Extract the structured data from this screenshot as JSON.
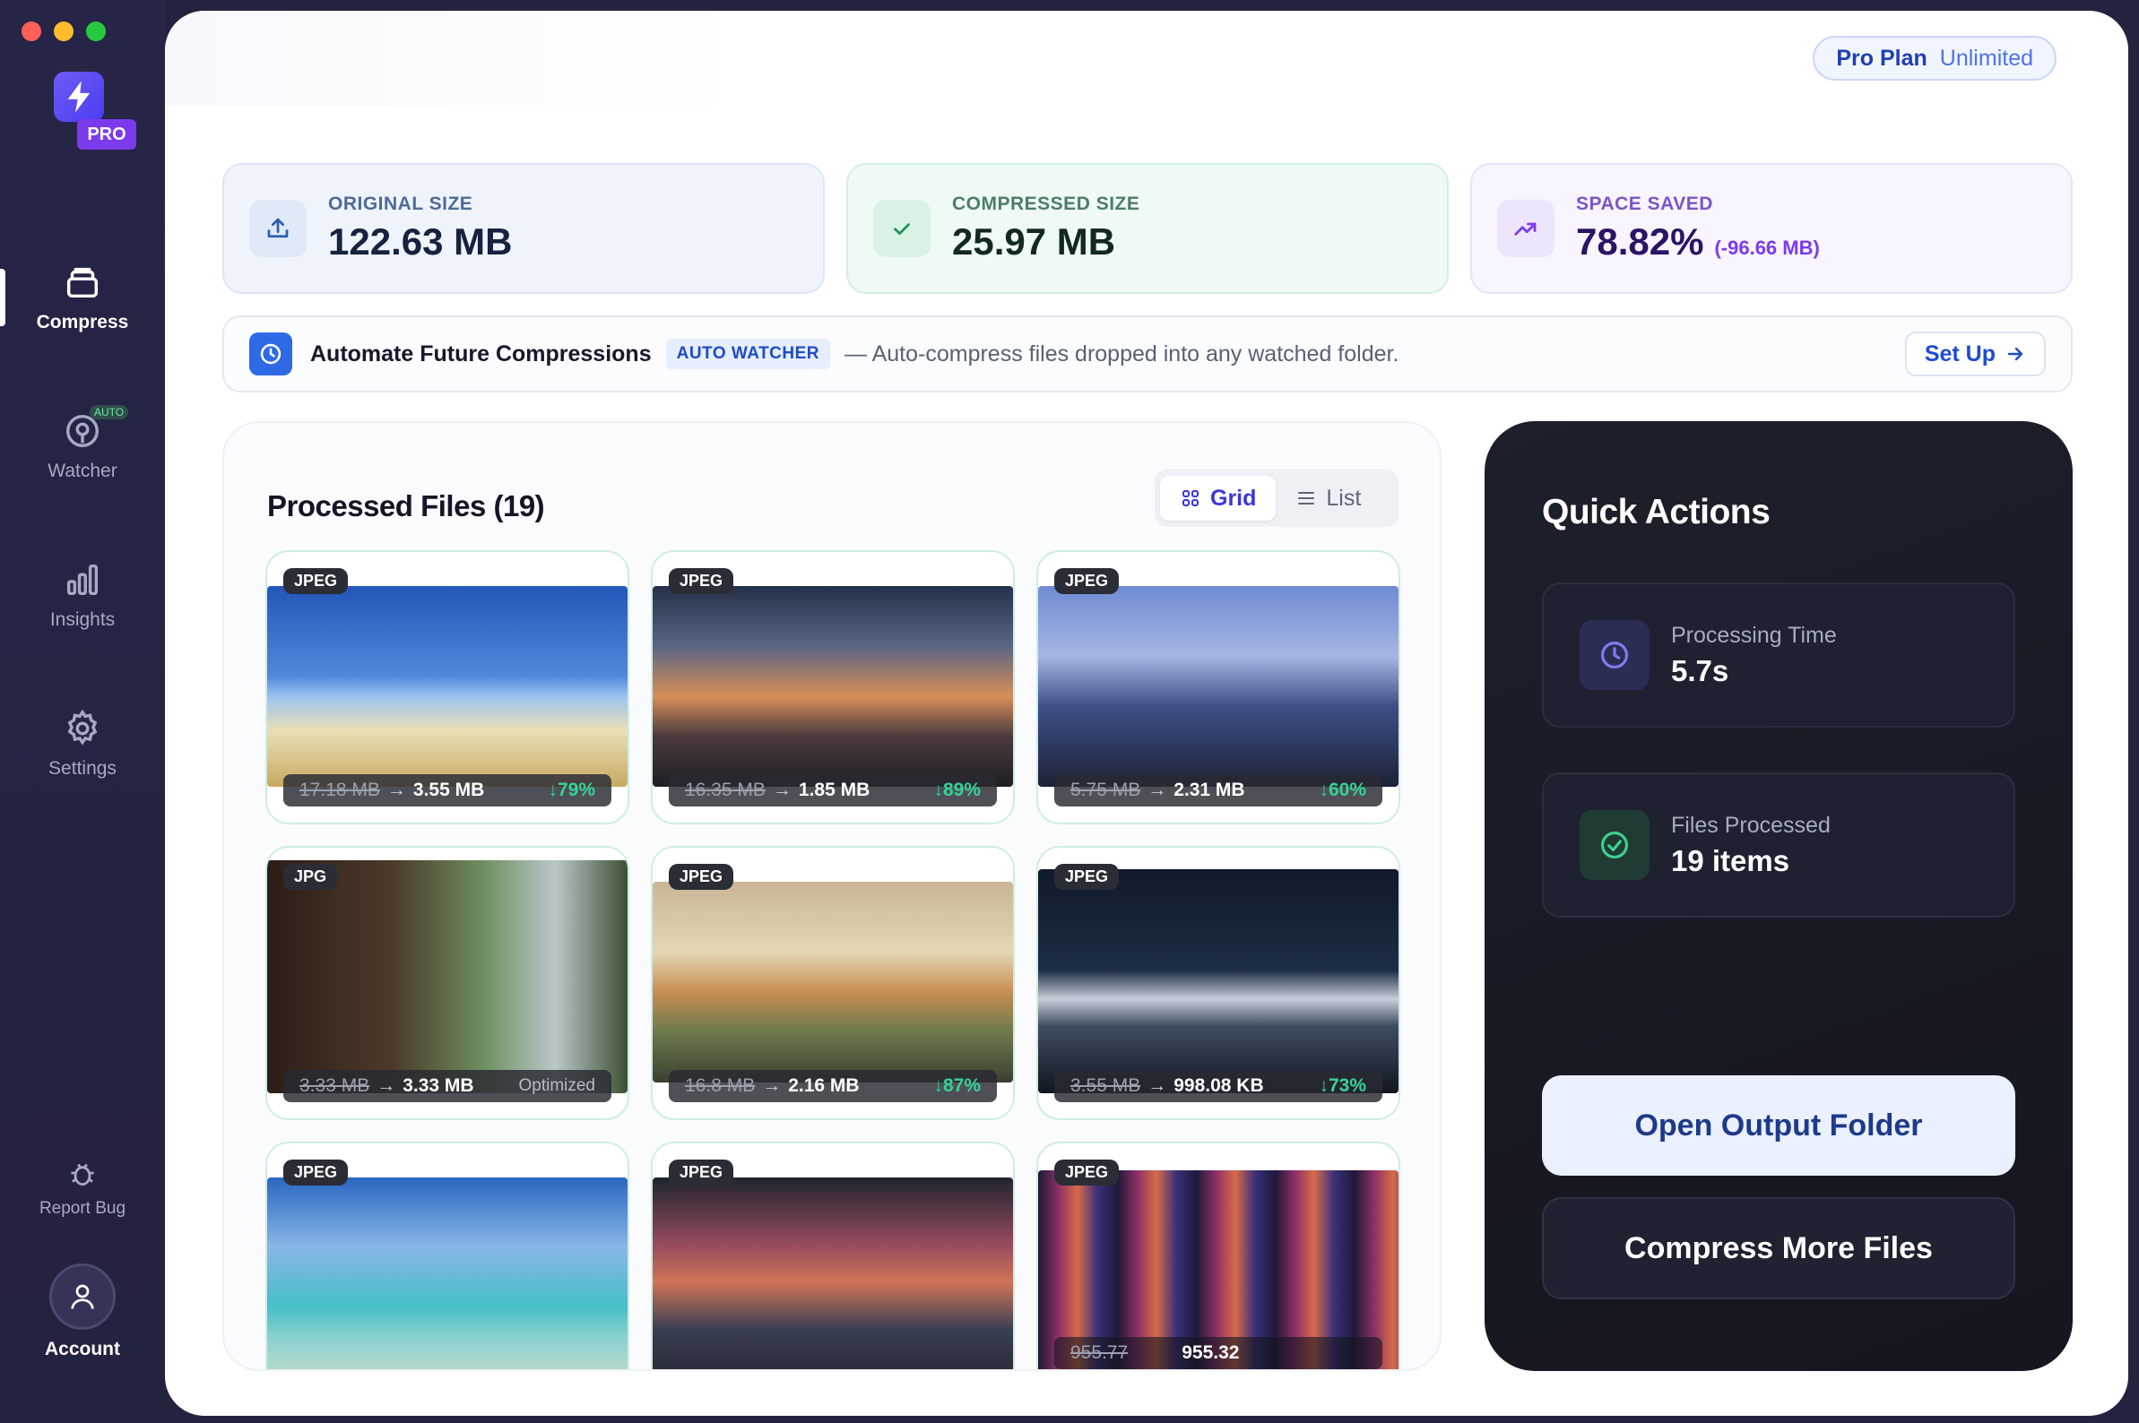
{
  "window": {
    "traffic_lights": [
      "close",
      "minimize",
      "zoom"
    ]
  },
  "sidebar": {
    "brand_badge": "PRO",
    "items": [
      {
        "label": "Compress",
        "icon": "stack-icon",
        "active": true
      },
      {
        "label": "Watcher",
        "icon": "watch-eye-icon",
        "badge": "AUTO"
      },
      {
        "label": "Insights",
        "icon": "bar-chart-icon"
      },
      {
        "label": "Settings",
        "icon": "gear-icon"
      }
    ],
    "report_bug": "Report Bug",
    "account": "Account"
  },
  "header": {
    "plan": "Pro Plan",
    "plan_tier": "Unlimited"
  },
  "stats": {
    "original": {
      "label": "ORIGINAL SIZE",
      "value": "122.63 MB"
    },
    "compressed": {
      "label": "COMPRESSED SIZE",
      "value": "25.97 MB"
    },
    "saved": {
      "label": "SPACE SAVED",
      "value": "78.82%",
      "sub": "(-96.66 MB)"
    }
  },
  "automate": {
    "title": "Automate Future Compressions",
    "tag": "AUTO WATCHER",
    "description": "— Auto-compress files dropped into any watched folder.",
    "button": "Set Up"
  },
  "files": {
    "title": "Processed Files (19)",
    "view_grid": "Grid",
    "view_list": "List",
    "items": [
      {
        "format": "JPEG",
        "original": "17.18 MB",
        "compressed": "3.55 MB",
        "saving": "↓79%"
      },
      {
        "format": "JPEG",
        "original": "16.35 MB",
        "compressed": "1.85 MB",
        "saving": "↓89%"
      },
      {
        "format": "JPEG",
        "original": "5.75 MB",
        "compressed": "2.31 MB",
        "saving": "↓60%"
      },
      {
        "format": "JPG",
        "original": "3.33 MB",
        "compressed": "3.33 MB",
        "saving": "Optimized"
      },
      {
        "format": "JPEG",
        "original": "16.8 MB",
        "compressed": "2.16 MB",
        "saving": "↓87%"
      },
      {
        "format": "JPEG",
        "original": "3.55 MB",
        "compressed": "998.08 KB",
        "saving": "↓73%"
      },
      {
        "format": "JPEG"
      },
      {
        "format": "JPEG"
      },
      {
        "format": "JPEG",
        "original": "955.77",
        "compressed": "955.32"
      }
    ]
  },
  "quick_actions": {
    "title": "Quick Actions",
    "processing_time": {
      "label": "Processing Time",
      "value": "5.7s"
    },
    "files_processed": {
      "label": "Files Processed",
      "value": "19 items"
    },
    "open_folder": "Open Output Folder",
    "compress_more": "Compress More Files"
  }
}
